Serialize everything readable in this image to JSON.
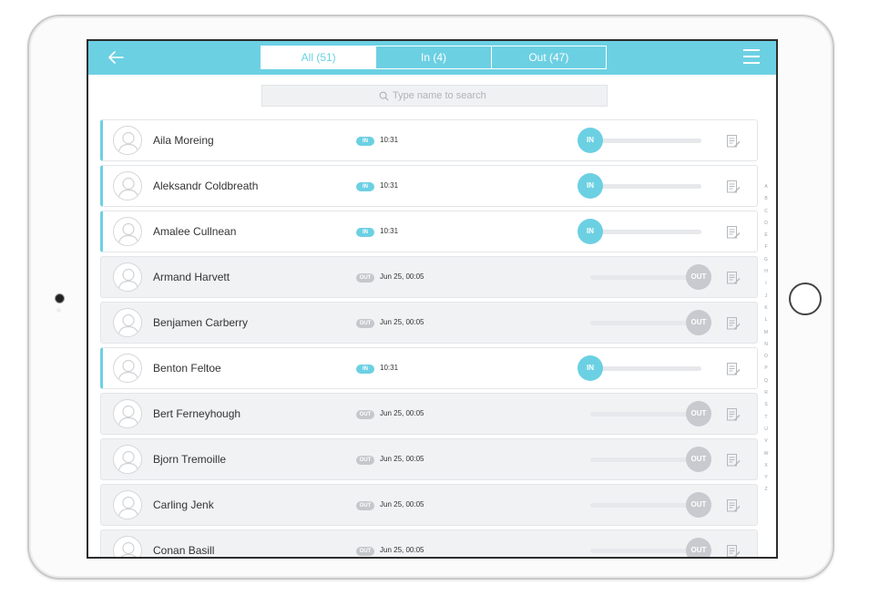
{
  "tabs": [
    {
      "label": "All  (51)",
      "active": true
    },
    {
      "label": "In  (4)",
      "active": false
    },
    {
      "label": "Out  (47)",
      "active": false
    }
  ],
  "search": {
    "placeholder": "Type name to search"
  },
  "people": [
    {
      "name": "Aila Moreing",
      "status": "IN",
      "time": "10:31"
    },
    {
      "name": "Aleksandr Coldbreath",
      "status": "IN",
      "time": "10:31"
    },
    {
      "name": "Amalee Cullnean",
      "status": "IN",
      "time": "10:31"
    },
    {
      "name": "Armand Harvett",
      "status": "OUT",
      "time": "Jun 25, 00:05"
    },
    {
      "name": "Benjamen Carberry",
      "status": "OUT",
      "time": "Jun 25, 00:05"
    },
    {
      "name": "Benton Feltoe",
      "status": "IN",
      "time": "10:31"
    },
    {
      "name": "Bert Ferneyhough",
      "status": "OUT",
      "time": "Jun 25, 00:05"
    },
    {
      "name": "Bjorn Tremoille",
      "status": "OUT",
      "time": "Jun 25, 00:05"
    },
    {
      "name": "Carling Jenk",
      "status": "OUT",
      "time": "Jun 25, 00:05"
    },
    {
      "name": "Conan Basill",
      "status": "OUT",
      "time": "Jun 25, 00:05"
    }
  ],
  "alphabet": [
    "A",
    "B",
    "C",
    "D",
    "E",
    "F",
    "G",
    "H",
    "I",
    "J",
    "K",
    "L",
    "M",
    "N",
    "O",
    "P",
    "Q",
    "R",
    "S",
    "T",
    "U",
    "V",
    "W",
    "X",
    "Y",
    "Z"
  ],
  "colors": {
    "accent": "#6cd0e3",
    "out": "#c8cacf"
  },
  "icons": {
    "back": "arrow-left-icon",
    "menu": "hamburger-menu-icon",
    "search": "search-icon",
    "avatar": "user-avatar-icon",
    "note": "edit-note-icon"
  }
}
